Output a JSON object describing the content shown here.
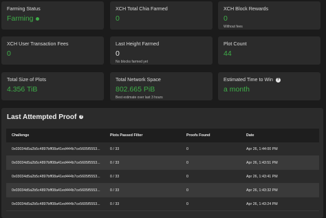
{
  "cards": [
    {
      "label": "Farming Status",
      "value": "Farming",
      "sub": ""
    },
    {
      "label": "XCH Total Chia Farmed",
      "value": "0",
      "sub": ""
    },
    {
      "label": "XCH Block Rewards",
      "value": "0",
      "sub": "Without fees"
    },
    {
      "label": "XCH User Transaction Fees",
      "value": "0",
      "sub": ""
    },
    {
      "label": "Last Height Farmed",
      "value": "0",
      "sub": "No blocks farmed yet"
    },
    {
      "label": "Plot Count",
      "value": "44",
      "sub": ""
    },
    {
      "label": "Total Size of Plots",
      "value": "4.356 TiB",
      "sub": ""
    },
    {
      "label": "Total Network Space",
      "value": "802.665 PiB",
      "sub": "Best estimate over last 3 hours"
    },
    {
      "label": "Estimated Time to Win",
      "value": "a month",
      "sub": ""
    }
  ],
  "colors": {
    "green": "#3fae49",
    "card": "#2b2b2b",
    "background": "#1b1b1b"
  },
  "proof": {
    "title": "Last Attempted Proof",
    "columns": [
      "Challenge",
      "Plots Passed Filter",
      "Proofs Found",
      "Date"
    ],
    "rows": [
      {
        "challenge": "0x03034d5a2b5c4897bff08a41ed444b7ce5605f5553...",
        "plots": "0 / 33",
        "proofs": "0",
        "date": "Apr 26, 1:44:00 PM"
      },
      {
        "challenge": "0x03034d5a2b5c4897bff08a41ed444b7ce5605f5553...",
        "plots": "0 / 33",
        "proofs": "0",
        "date": "Apr 26, 1:43:51 PM"
      },
      {
        "challenge": "0x03034d5a2b5c4897bff08a41ed444b7ce5605f5553...",
        "plots": "0 / 33",
        "proofs": "0",
        "date": "Apr 26, 1:43:41 PM"
      },
      {
        "challenge": "0x03034d5a2b5c4897bff08a41ed444b7ce5605f5553...",
        "plots": "0 / 33",
        "proofs": "0",
        "date": "Apr 26, 1:43:32 PM"
      },
      {
        "challenge": "0x03034d5a2b5c4897bff08a41ed444b7ce5605f5553...",
        "plots": "0 / 33",
        "proofs": "0",
        "date": "Apr 26, 1:43:24 PM"
      }
    ]
  }
}
